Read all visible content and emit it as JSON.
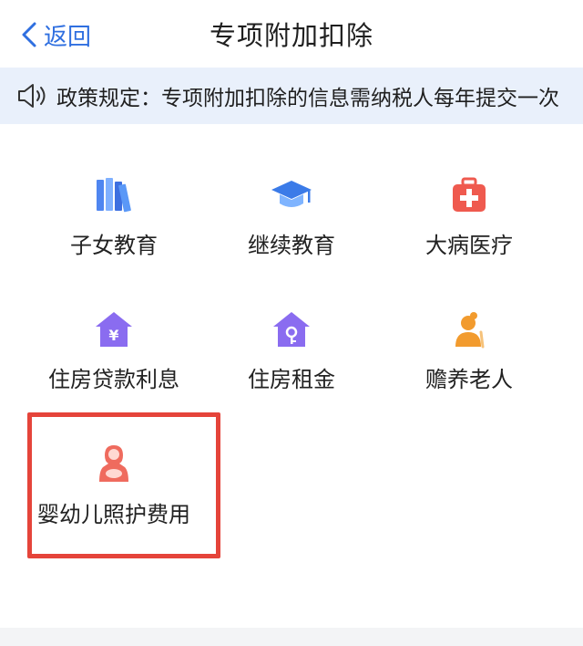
{
  "header": {
    "back_label": "返回",
    "title": "专项附加扣除"
  },
  "notice": {
    "text": "政策规定：专项附加扣除的信息需纳税人每年提交一次"
  },
  "items": [
    {
      "label": "子女教育",
      "icon": "books-icon"
    },
    {
      "label": "继续教育",
      "icon": "graduation-cap-icon"
    },
    {
      "label": "大病医疗",
      "icon": "medical-kit-icon"
    },
    {
      "label": "住房贷款利息",
      "icon": "house-yuan-icon"
    },
    {
      "label": "住房租金",
      "icon": "house-key-icon"
    },
    {
      "label": "赡养老人",
      "icon": "elderly-person-icon"
    },
    {
      "label": "婴幼儿照护费用",
      "icon": "mother-baby-icon"
    }
  ],
  "colors": {
    "accent": "#2f6fe0",
    "notice_bg": "#e9f0fb",
    "highlight": "#e5443a",
    "purple": "#8a6cf0",
    "red": "#ef5a4f",
    "orange": "#f29b2e"
  }
}
